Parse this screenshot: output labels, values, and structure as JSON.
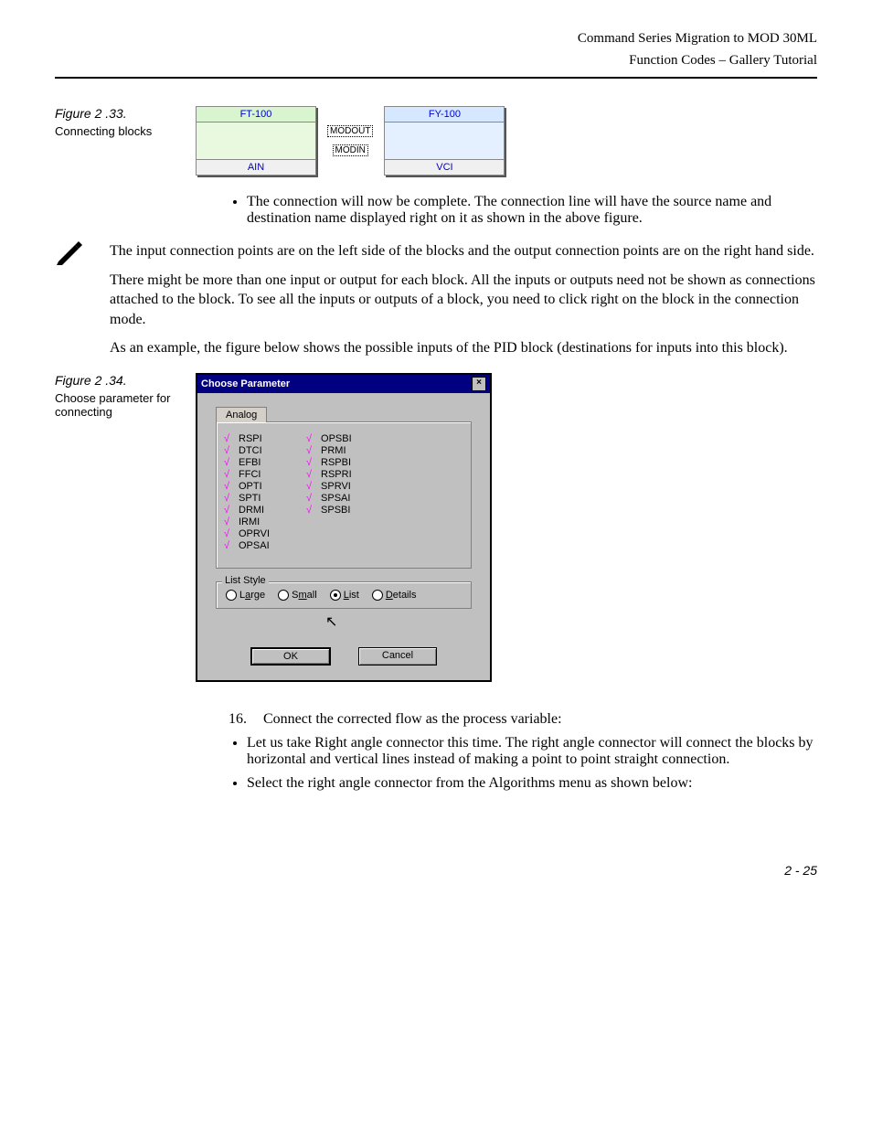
{
  "header": {
    "line1": "Command Series Migration to MOD 30ML",
    "line2": "Function Codes – Gallery Tutorial"
  },
  "fig33": {
    "label": "Figure 2 .33.",
    "caption": "Connecting blocks",
    "left_block_title": "FT-100",
    "left_block_footer": "AIN",
    "right_block_title": "FY-100",
    "right_block_footer": "VCI",
    "mid_top": "MODOUT",
    "mid_bottom": "MODIN"
  },
  "text": {
    "bullet1": "The connection will now be complete. The connection line will have the source name and destination name displayed right on it as shown in the above figure.",
    "note_p1": "The input connection points are on the left side of the blocks and the output connection points are on the right hand side.",
    "note_p2": "There might be more than one input or output for each block. All the inputs or outputs need not be shown as connections attached to the block. To see all the inputs or outputs of a block, you need to click right on the block in the connection mode.",
    "note_p3": "As an example, the figure below shows the possible inputs of the PID block (destinations for inputs into this block).",
    "step16_num": "16.",
    "step16": "Connect the corrected flow as the process variable:",
    "sub1": "Let us take Right angle connector this time. The right angle connector will connect the blocks by horizontal and vertical lines instead of making a point to point straight connection.",
    "sub2": "Select the right angle connector from the Algorithms menu as shown below:"
  },
  "fig34": {
    "label": "Figure 2 .34.",
    "caption": "Choose parameter for connecting"
  },
  "dialog": {
    "title": "Choose Parameter",
    "tab": "Analog",
    "col1": [
      "RSPI",
      "DTCI",
      "EFBI",
      "FFCI",
      "OPTI",
      "SPTI",
      "DRMI",
      "IRMI",
      "OPRVI",
      "OPSAI"
    ],
    "col2": [
      "OPSBI",
      "PRMI",
      "RSPBI",
      "RSPRI",
      "SPRVI",
      "SPSAI",
      "SPSBI"
    ],
    "group_label": "List Style",
    "radios": {
      "large": "Large",
      "small": "Small",
      "list": "List",
      "details": "Details",
      "selected": "list"
    },
    "ok": "OK",
    "cancel": "Cancel"
  },
  "page_number": "2 - 25"
}
